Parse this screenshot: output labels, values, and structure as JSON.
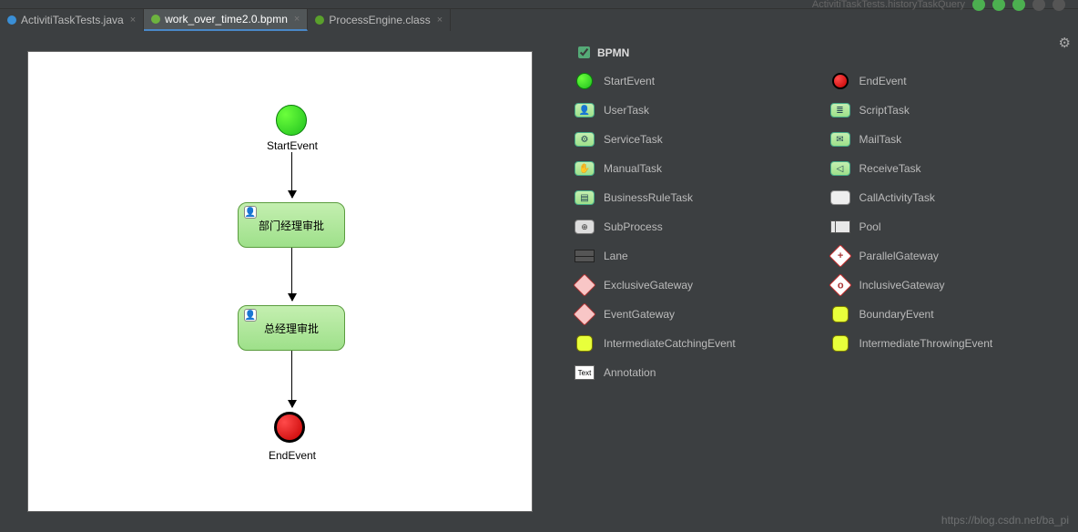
{
  "tabs": [
    {
      "label": "ActivitiTaskTests.java",
      "icon_color": "#3a8fd6",
      "active": false
    },
    {
      "label": "work_over_time2.0.bpmn",
      "icon_color": "#6db33f",
      "active": true
    },
    {
      "label": "ProcessEngine.class",
      "icon_color": "#5aa02c",
      "active": false
    }
  ],
  "header_dropdown": "ActivitiTaskTests.historyTaskQuery",
  "diagram": {
    "start_label": "StartEvent",
    "task1_label": "部门经理审批",
    "task2_label": "总经理审批",
    "end_label": "EndEvent"
  },
  "palette": {
    "title": "BPMN",
    "items_left": [
      {
        "label": "StartEvent",
        "icon": "start"
      },
      {
        "label": "UserTask",
        "icon": "box-green",
        "inner": "👤"
      },
      {
        "label": "ServiceTask",
        "icon": "box-green",
        "inner": "⚙"
      },
      {
        "label": "ManualTask",
        "icon": "box-green",
        "inner": "✋"
      },
      {
        "label": "BusinessRuleTask",
        "icon": "box-green",
        "inner": "▤"
      },
      {
        "label": "SubProcess",
        "icon": "sub",
        "inner": "⊕"
      },
      {
        "label": "Lane",
        "icon": "lane"
      },
      {
        "label": "ExclusiveGateway",
        "icon": "diamond"
      },
      {
        "label": "EventGateway",
        "icon": "diamond"
      },
      {
        "label": "IntermediateCatchingEvent",
        "icon": "yellow"
      },
      {
        "label": "Annotation",
        "icon": "text",
        "inner": "Text"
      }
    ],
    "items_right": [
      {
        "label": "EndEvent",
        "icon": "end"
      },
      {
        "label": "ScriptTask",
        "icon": "box-green",
        "inner": "≣"
      },
      {
        "label": "MailTask",
        "icon": "box-green",
        "inner": "✉"
      },
      {
        "label": "ReceiveTask",
        "icon": "box-green",
        "inner": "◁"
      },
      {
        "label": "CallActivityTask",
        "icon": "white"
      },
      {
        "label": "Pool",
        "icon": "pool"
      },
      {
        "label": "ParallelGateway",
        "icon": "diamond2",
        "inner": "+"
      },
      {
        "label": "InclusiveGateway",
        "icon": "diamond2",
        "inner": "o"
      },
      {
        "label": "BoundaryEvent",
        "icon": "yellow"
      },
      {
        "label": "IntermediateThrowingEvent",
        "icon": "yellow"
      }
    ]
  },
  "watermark": "https://blog.csdn.net/ba_pi"
}
